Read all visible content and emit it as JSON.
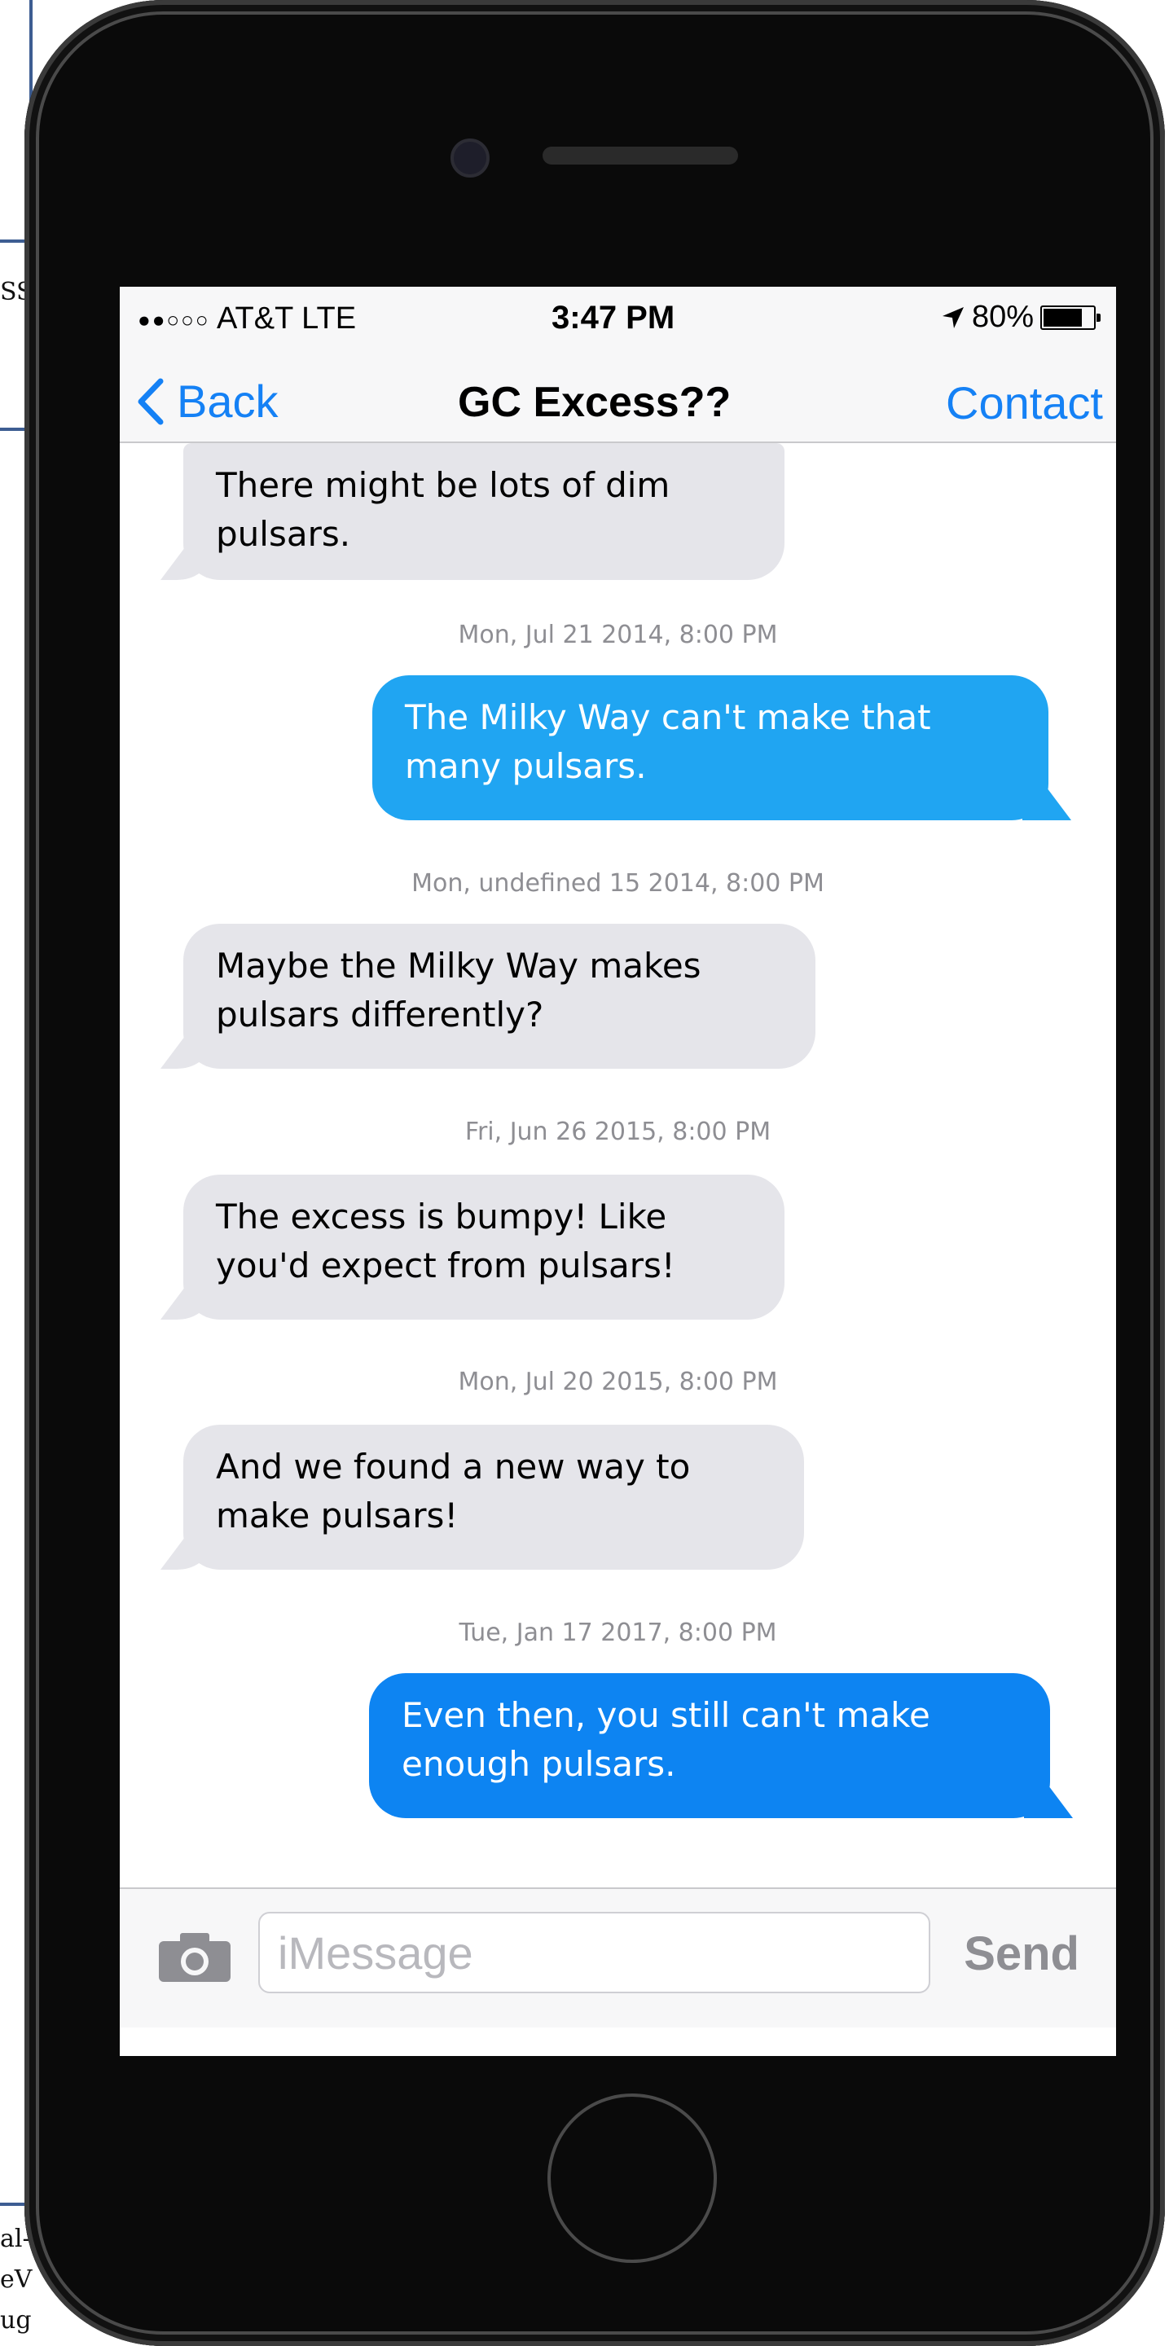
{
  "page_fragments": {
    "top_right_text": "SS",
    "bottom_lines": [
      "al-",
      "eV",
      "ug"
    ]
  },
  "status_bar": {
    "signal": "●●○○○",
    "carrier": "AT&T LTE",
    "time": "3:47 PM",
    "battery": "80%",
    "battery_level": 0.8
  },
  "nav": {
    "back_label": "Back",
    "title": "GC Excess??",
    "contact_label": "Contact"
  },
  "messages": [
    {
      "type": "received",
      "text": "There might be lots of dim pulsars."
    },
    {
      "type": "timestamp",
      "text": "Mon, Jul 21 2014, 8:00 PM"
    },
    {
      "type": "sent",
      "text": "The Milky Way can't make that many pulsars."
    },
    {
      "type": "timestamp",
      "text": "Mon, undefined 15 2014, 8:00 PM"
    },
    {
      "type": "received",
      "text": "Maybe the Milky Way makes pulsars differently?"
    },
    {
      "type": "timestamp",
      "text": "Fri, Jun 26 2015, 8:00 PM"
    },
    {
      "type": "received",
      "text": "The excess is bumpy! Like you'd expect from pulsars!"
    },
    {
      "type": "timestamp",
      "text": "Mon, Jul 20 2015, 8:00 PM"
    },
    {
      "type": "received",
      "text": "And we found a new way to make pulsars!"
    },
    {
      "type": "timestamp",
      "text": "Tue, Jan 17 2017, 8:00 PM"
    },
    {
      "type": "sent",
      "text": "Even then, you still can't make enough pulsars."
    }
  ],
  "input_bar": {
    "placeholder": "iMessage",
    "send_label": "Send"
  },
  "colors": {
    "ios_blue": "#1581f5",
    "sent_bubble_1": "#20a5f2",
    "sent_bubble_2": "#0d84f2",
    "received_bubble": "#e5e5ea"
  }
}
